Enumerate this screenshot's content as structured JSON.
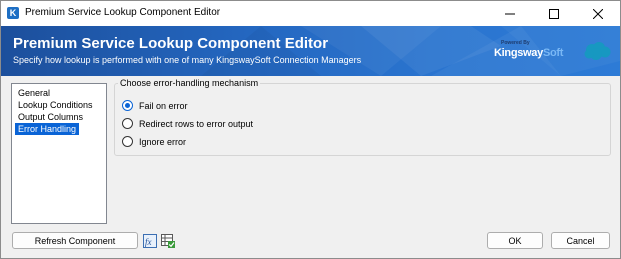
{
  "window": {
    "title": "Premium Service Lookup Component Editor",
    "app_icon_letter": "K",
    "accent_color": "#0a64d6"
  },
  "banner": {
    "title": "Premium Service Lookup Component Editor",
    "subtitle": "Specify how lookup is performed with one of many KingswaySoft Connection Managers",
    "logo": {
      "powered_by": "Powered By",
      "brand_main": "Kingsway",
      "brand_suffix": "Soft",
      "partner_icon": "salesforce-cloud-icon"
    },
    "gradient_start": "#1c4f9c",
    "gradient_end": "#2d7bd6"
  },
  "sidebar": {
    "items": [
      {
        "label": "General",
        "selected": false
      },
      {
        "label": "Lookup Conditions",
        "selected": false
      },
      {
        "label": "Output Columns",
        "selected": false
      },
      {
        "label": "Error Handling",
        "selected": true
      }
    ]
  },
  "error_handling": {
    "legend": "Choose error-handling mechanism",
    "options": [
      {
        "label": "Fail on error",
        "checked": true
      },
      {
        "label": "Redirect rows to error output",
        "checked": false
      },
      {
        "label": "Ignore error",
        "checked": false
      }
    ]
  },
  "footer": {
    "refresh_label": "Refresh Component",
    "expression_icon": "fx-icon",
    "variables_icon": "grid-check-icon",
    "ok_label": "OK",
    "cancel_label": "Cancel"
  }
}
